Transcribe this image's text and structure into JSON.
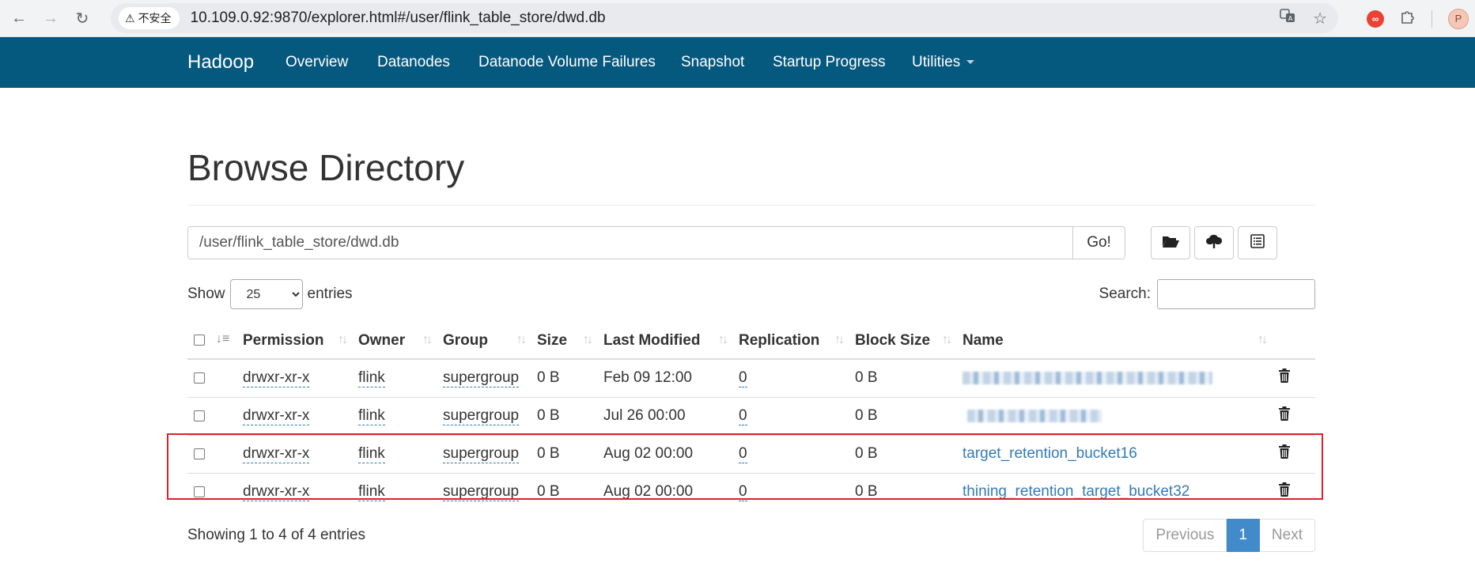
{
  "browser": {
    "security_label": "不安全",
    "url": "10.109.0.92:9870/explorer.html#/user/flink_table_store/dwd.db",
    "profile_initial": "P",
    "extension_badge": "∞"
  },
  "navbar": {
    "brand": "Hadoop",
    "items": [
      {
        "label": "Overview"
      },
      {
        "label": "Datanodes"
      },
      {
        "label": "Datanode Volume Failures"
      },
      {
        "label": "Snapshot"
      },
      {
        "label": "Startup Progress"
      },
      {
        "label": "Utilities"
      }
    ]
  },
  "page": {
    "title": "Browse Directory",
    "path_value": "/user/flink_table_store/dwd.db",
    "go_label": "Go!"
  },
  "table_controls": {
    "show_label": "Show",
    "page_length": "25",
    "entries_label": "entries",
    "search_label": "Search:"
  },
  "table": {
    "columns": [
      "Permission",
      "Owner",
      "Group",
      "Size",
      "Last Modified",
      "Replication",
      "Block Size",
      "Name"
    ],
    "rows": [
      {
        "permission": "drwxr-xr-x",
        "owner": "flink",
        "group": "supergroup",
        "size": "0 B",
        "modified": "Feb 09 12:00",
        "replication": "0",
        "block_size": "0 B",
        "name": ""
      },
      {
        "permission": "drwxr-xr-x",
        "owner": "flink",
        "group": "supergroup",
        "size": "0 B",
        "modified": "Jul 26 00:00",
        "replication": "0",
        "block_size": "0 B",
        "name": ""
      },
      {
        "permission": "drwxr-xr-x",
        "owner": "flink",
        "group": "supergroup",
        "size": "0 B",
        "modified": "Aug 02 00:00",
        "replication": "0",
        "block_size": "0 B",
        "name": "target_retention_bucket16"
      },
      {
        "permission": "drwxr-xr-x",
        "owner": "flink",
        "group": "supergroup",
        "size": "0 B",
        "modified": "Aug 02 00:00",
        "replication": "0",
        "block_size": "0 B",
        "name": "thining_retention_target_bucket32"
      }
    ]
  },
  "footer": {
    "info": "Showing 1 to 4 of 4 entries",
    "previous": "Previous",
    "page": "1",
    "next": "Next"
  },
  "colors": {
    "navbar": "#05587e",
    "link": "#337ab7",
    "highlight": "#d8232a",
    "pager_active": "#428bca"
  }
}
